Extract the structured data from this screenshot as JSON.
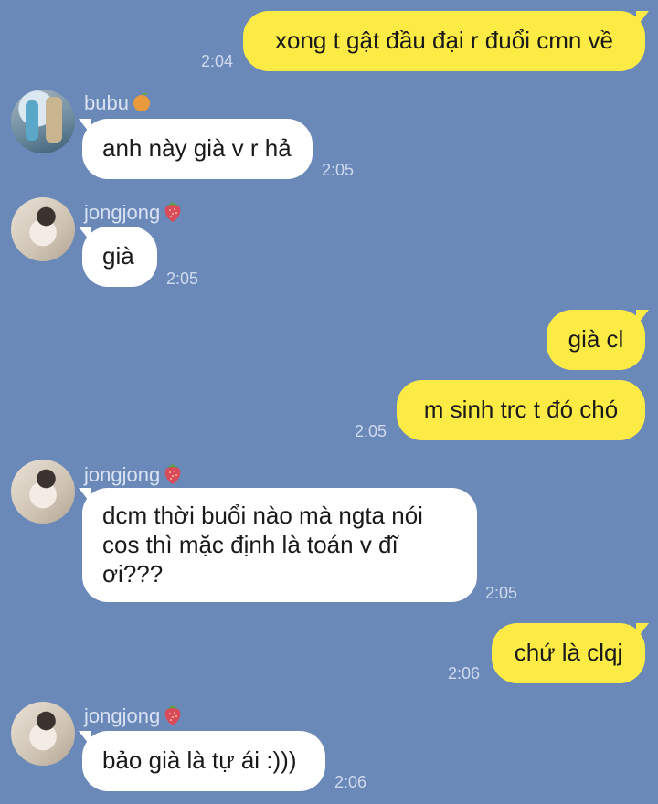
{
  "messages": [
    {
      "text": "xong t gật đầu đại r đuổi cmn về",
      "time": "2:04"
    },
    {
      "sender": "bubu",
      "text": "anh này già v r hả",
      "time": "2:05"
    },
    {
      "sender": "jongjong",
      "text": "già",
      "time": "2:05"
    },
    {
      "text": "già cl"
    },
    {
      "text": "m sinh trc t đó chó",
      "time": "2:05"
    },
    {
      "sender": "jongjong",
      "text_lines": [
        "dcm thời buổi nào mà ngta nói",
        "cos thì mặc định là toán v đĩ",
        "ơi???"
      ],
      "time": "2:05"
    },
    {
      "text": "chứ là clqj",
      "time": "2:06"
    },
    {
      "sender": "jongjong",
      "text": "bảo già là tự ái :)))",
      "time": "2:06"
    }
  ],
  "icons": {
    "bubu_emoji": "orange-icon",
    "jongjong_emoji": "strawberry-icon"
  },
  "colors": {
    "background": "#6a88b8",
    "outgoing_bubble": "#fbeb44",
    "incoming_bubble": "#ffffff"
  }
}
